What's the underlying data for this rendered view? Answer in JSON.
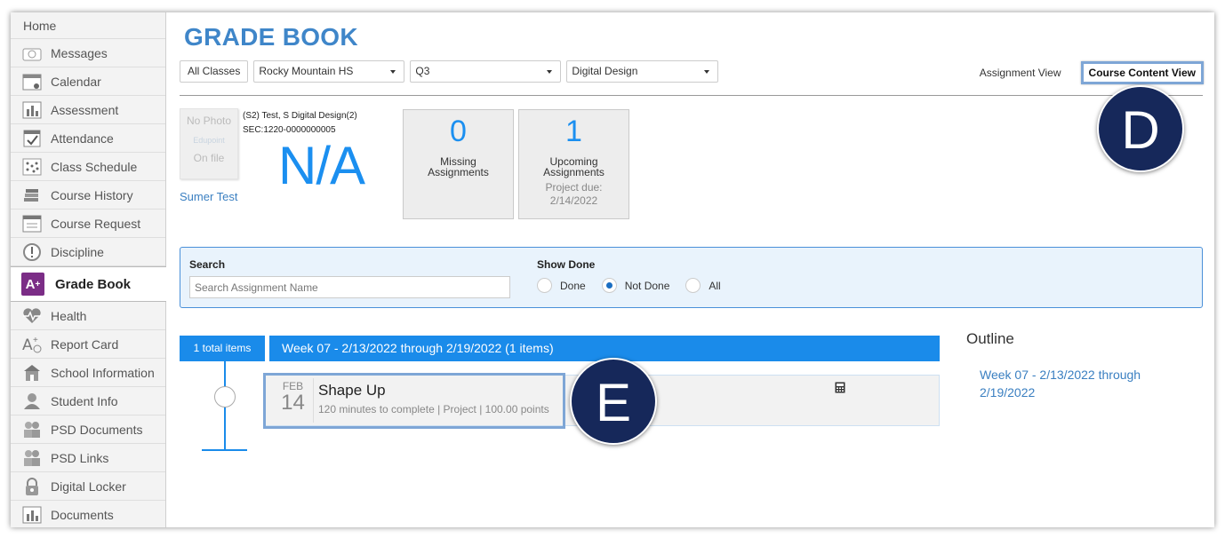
{
  "sidebar": {
    "home": "Home",
    "items": [
      {
        "label": "Messages",
        "icon": "messages-icon"
      },
      {
        "label": "Calendar",
        "icon": "calendar-icon"
      },
      {
        "label": "Assessment",
        "icon": "assessment-icon"
      },
      {
        "label": "Attendance",
        "icon": "attendance-icon"
      },
      {
        "label": "Class Schedule",
        "icon": "class-schedule-icon"
      },
      {
        "label": "Course History",
        "icon": "course-history-icon"
      },
      {
        "label": "Course Request",
        "icon": "course-request-icon"
      },
      {
        "label": "Discipline",
        "icon": "discipline-icon"
      },
      {
        "label": "Grade Book",
        "icon": "grade-book-icon",
        "active": true
      },
      {
        "label": "Health",
        "icon": "health-icon"
      },
      {
        "label": "Report Card",
        "icon": "report-card-icon"
      },
      {
        "label": "School Information",
        "icon": "school-icon"
      },
      {
        "label": "Student Info",
        "icon": "student-info-icon"
      },
      {
        "label": "PSD Documents",
        "icon": "psd-documents-icon"
      },
      {
        "label": "PSD Links",
        "icon": "psd-links-icon"
      },
      {
        "label": "Digital Locker",
        "icon": "lock-icon"
      },
      {
        "label": "Documents",
        "icon": "documents-icon"
      }
    ]
  },
  "header": {
    "title": "GRADE BOOK",
    "all_classes": "All Classes",
    "school_select": "Rocky Mountain HS",
    "term_select": "Q3",
    "class_select": "Digital Design",
    "assignment_view": "Assignment View",
    "course_content_view": "Course Content View"
  },
  "student": {
    "photo_line1": "No Photo",
    "photo_logo": "Edupoint",
    "photo_line2": "On file",
    "class_line": "(S2) Test, S Digital Design(2)",
    "section_line": "SEC:1220-0000000005",
    "name": "Sumer Test",
    "grade": "N/A"
  },
  "stats": {
    "missing_count": "0",
    "missing_label1": "Missing",
    "missing_label2": "Assignments",
    "upcoming_count": "1",
    "upcoming_label1": "Upcoming",
    "upcoming_label2": "Assignments",
    "upcoming_due1": "Project due:",
    "upcoming_due2": "2/14/2022"
  },
  "callouts": {
    "d": "D",
    "e": "E"
  },
  "search": {
    "label": "Search",
    "placeholder": "Search Assignment Name",
    "show_done_label": "Show Done",
    "options": [
      "Done",
      "Not Done",
      "All"
    ],
    "selected": "Not Done"
  },
  "list": {
    "total": "1 total items",
    "week_header": "Week 07 - 2/13/2022 through 2/19/2022  (1 items)",
    "assignment": {
      "month": "FEB",
      "day": "14",
      "name": "Shape Up",
      "meta": "120 minutes to complete | Project | 100.00 points"
    }
  },
  "outline": {
    "heading": "Outline",
    "link": "Week 07 - 2/13/2022 through 2/19/2022"
  },
  "colors": {
    "accent": "#1a8bea",
    "title": "#3f86c9",
    "badge": "#16285a",
    "active_icon": "#7b2d86"
  }
}
